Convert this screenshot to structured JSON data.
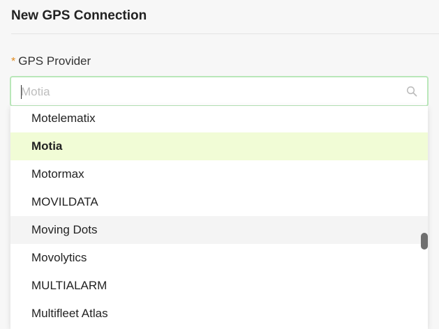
{
  "dialog": {
    "title": "New GPS Connection"
  },
  "form": {
    "required_mark": "*",
    "provider_label": "GPS Provider",
    "search": {
      "value": "",
      "placeholder": "Motia"
    }
  },
  "dropdown": {
    "options": [
      {
        "label": "Motelematix",
        "state": "normal"
      },
      {
        "label": "Motia",
        "state": "selected"
      },
      {
        "label": "Motormax",
        "state": "normal"
      },
      {
        "label": "MOVILDATA",
        "state": "normal"
      },
      {
        "label": "Moving Dots",
        "state": "hovered"
      },
      {
        "label": "Movolytics",
        "state": "normal"
      },
      {
        "label": "MULTIALARM",
        "state": "normal"
      },
      {
        "label": "Multifleet Atlas",
        "state": "normal"
      }
    ]
  },
  "colors": {
    "required_mark": "#e08a1e",
    "focus_border": "#b9e7b9",
    "selected_bg": "#f1fcd6",
    "hover_bg": "#f4f4f4"
  },
  "icons": {
    "search": "search-icon"
  }
}
